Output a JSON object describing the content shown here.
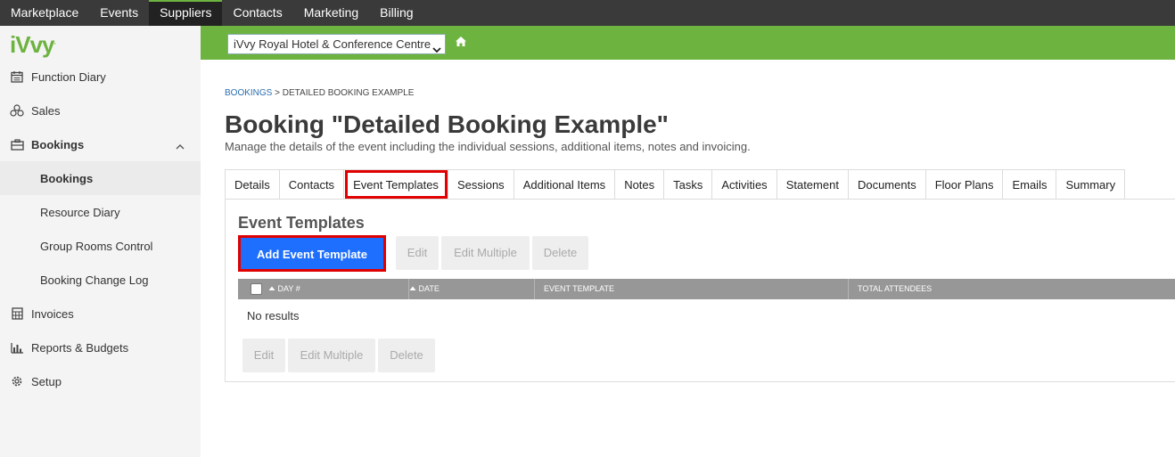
{
  "topnav": {
    "items": [
      {
        "label": "Marketplace"
      },
      {
        "label": "Events"
      },
      {
        "label": "Suppliers",
        "active": true
      },
      {
        "label": "Contacts"
      },
      {
        "label": "Marketing"
      },
      {
        "label": "Billing"
      }
    ]
  },
  "logo": {
    "text": "iVvy",
    "mark": "."
  },
  "sidebar": {
    "items": [
      {
        "label": "Function Diary",
        "icon": "calendar-icon"
      },
      {
        "label": "Sales",
        "icon": "sales-network-icon"
      },
      {
        "label": "Bookings",
        "icon": "briefcase-icon",
        "expanded": true
      },
      {
        "label": "Bookings",
        "current": true
      },
      {
        "label": "Resource Diary"
      },
      {
        "label": "Group Rooms Control"
      },
      {
        "label": "Booking Change Log"
      },
      {
        "label": "Invoices",
        "icon": "calculator-icon"
      },
      {
        "label": "Reports & Budgets",
        "icon": "bar-chart-icon"
      },
      {
        "label": "Setup",
        "icon": "gear-icon"
      }
    ]
  },
  "venue": {
    "selected": "iVvy Royal Hotel & Conference Centre"
  },
  "breadcrumb": {
    "root": "BOOKINGS",
    "separator": ">",
    "current": "DETAILED BOOKING EXAMPLE"
  },
  "page": {
    "title": "Booking \"Detailed Booking Example\"",
    "subtitle": "Manage the details of the event including the individual sessions, additional items, notes and invoicing."
  },
  "tabs": [
    {
      "label": "Details"
    },
    {
      "label": "Contacts"
    },
    {
      "label": "Event Templates",
      "active": true
    },
    {
      "label": "Sessions"
    },
    {
      "label": "Additional Items"
    },
    {
      "label": "Notes"
    },
    {
      "label": "Tasks"
    },
    {
      "label": "Activities"
    },
    {
      "label": "Statement"
    },
    {
      "label": "Documents"
    },
    {
      "label": "Floor Plans"
    },
    {
      "label": "Emails"
    },
    {
      "label": "Summary"
    }
  ],
  "section": {
    "title": "Event Templates",
    "add_label": "Add Event Template",
    "edit_label": "Edit",
    "edit_multiple_label": "Edit Multiple",
    "delete_label": "Delete"
  },
  "table": {
    "columns": [
      "DAY #",
      "DATE",
      "EVENT TEMPLATE",
      "TOTAL ATTENDEES"
    ],
    "empty_text": "No results"
  },
  "colors": {
    "brand_green": "#6db33f",
    "primary_blue": "#1f6fff",
    "highlight_red": "#e00000"
  }
}
